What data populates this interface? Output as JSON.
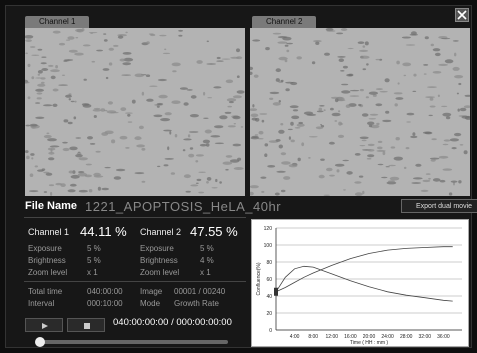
{
  "channels": [
    {
      "tab_label": "Channel 1"
    },
    {
      "tab_label": "Channel 2"
    }
  ],
  "file": {
    "label": "File Name",
    "value": "1221_APOPTOSIS_HeLA_40hr"
  },
  "export_label": "Export dual movie",
  "stats": {
    "ch1": {
      "label": "Channel 1",
      "value": "44.11 %",
      "exposure_label": "Exposure",
      "exposure": "5 %",
      "brightness_label": "Brightness",
      "brightness": "5 %",
      "zoom_label": "Zoom level",
      "zoom": "x 1"
    },
    "ch2": {
      "label": "Channel 2",
      "value": "47.55 %",
      "exposure_label": "Exposure",
      "exposure": "5 %",
      "brightness_label": "Brightness",
      "brightness": "4 %",
      "zoom_label": "Zoom level",
      "zoom": "x 1"
    },
    "total_time_label": "Total time",
    "total_time": "040:00:00",
    "interval_label": "Interval",
    "interval": "000:10:00",
    "image_label": "Image",
    "image": "00001 / 00240",
    "mode_label": "Mode",
    "mode": "Growth Rate"
  },
  "playback": {
    "time": "040:00:00:00 / 000:00:00:00",
    "position": 0.0
  },
  "chart_data": {
    "type": "line",
    "ylabel": "Confluence(%)",
    "xlabel": "Time ( HH : mm )",
    "ylim": [
      0,
      120
    ],
    "xlim": [
      0,
      40
    ],
    "yticks": [
      "0",
      "20",
      "40",
      "60",
      "80",
      "100",
      "120"
    ],
    "xticks": [
      "4:00",
      "8:00",
      "12:00",
      "16:00",
      "20:00",
      "24:00",
      "28:00",
      "32:00",
      "36:00"
    ],
    "series": [
      {
        "x": [
          0,
          2,
          4,
          6,
          8,
          12,
          16,
          20,
          24,
          28,
          32,
          36,
          38
        ],
        "y": [
          45,
          50,
          56,
          62,
          67,
          76,
          84,
          90,
          94,
          96,
          97,
          98,
          98
        ],
        "color": "#444"
      },
      {
        "x": [
          0,
          2,
          4,
          6,
          8,
          12,
          16,
          20,
          24,
          28,
          32,
          36,
          38
        ],
        "y": [
          45,
          62,
          72,
          75,
          74,
          66,
          58,
          51,
          45,
          41,
          38,
          35,
          34
        ],
        "color": "#444"
      }
    ]
  }
}
